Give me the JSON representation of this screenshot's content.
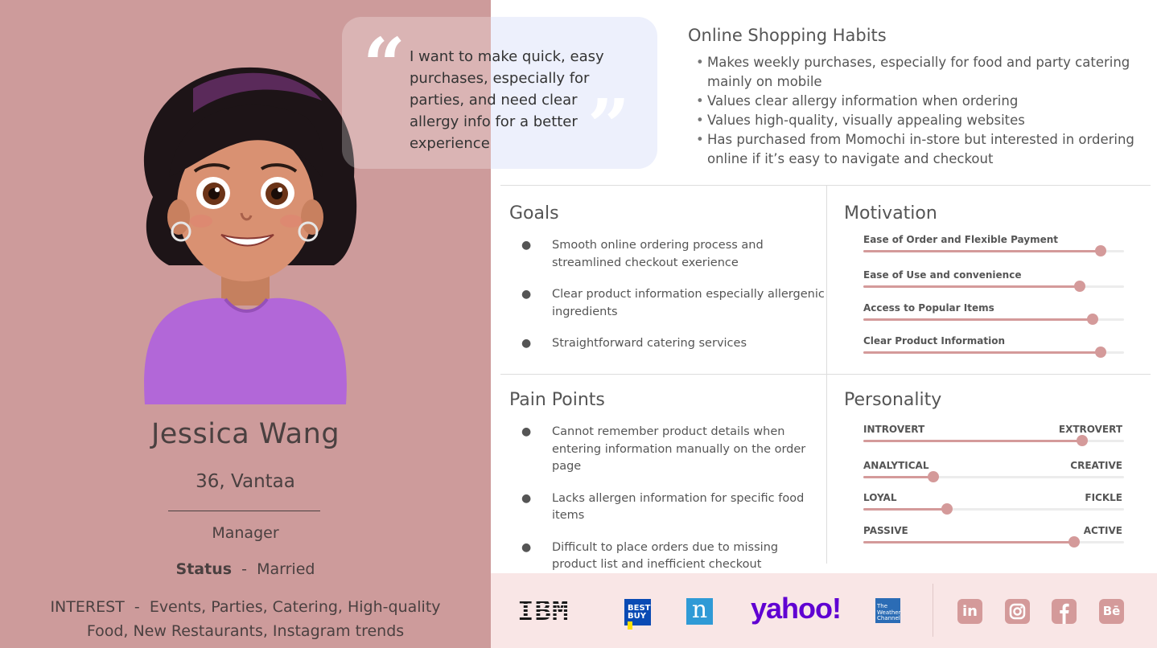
{
  "persona": {
    "name": "Jessica Wang",
    "age_location": "36, Vantaa",
    "job": "Manager",
    "status_label": "Status",
    "status_sep": "-",
    "status_value": "Married",
    "interest_label": "INTEREST",
    "interest_sep": "-",
    "interest_value": "Events, Parties, Catering, High-quality Food, New Restaurants, Instagram trends"
  },
  "quote": {
    "text": "I want to make quick, easy purchases, especially for parties, and need clear allergy info for a better experience"
  },
  "habits": {
    "title": "Online Shopping Habits",
    "items": [
      "Makes weekly purchases, especially for food and party catering mainly on mobile",
      "Values clear allergy information when ordering",
      "Values high-quality, visually appealing websites",
      "Has purchased from Momochi in-store but interested in ordering online if it’s easy to navigate and checkout"
    ]
  },
  "goals": {
    "title": "Goals",
    "bullet": "●",
    "items": [
      "Smooth online ordering process and streamlined checkout exerience",
      "Clear product information especially allergenic ingredients",
      "Straightforward catering services"
    ]
  },
  "pain_points": {
    "title": "Pain Points",
    "bullet": "●",
    "items": [
      "Cannot remember product details when entering information manually on the order page",
      "Lacks allergen information for specific food items",
      "Difficult to place orders due to missing product list and inefficient checkout"
    ]
  },
  "motivation": {
    "title": "Motivation",
    "items": [
      {
        "label": "Ease of Order and Flexible Payment",
        "value": 0.91
      },
      {
        "label": "Ease of Use and convenience",
        "value": 0.83
      },
      {
        "label": "Access to Popular Items",
        "value": 0.88
      },
      {
        "label": "Clear Product Information",
        "value": 0.91
      }
    ]
  },
  "personality": {
    "title": "Personality",
    "items": [
      {
        "left": "INTROVERT",
        "right": "EXTROVERT",
        "value": 0.84
      },
      {
        "left": "ANALYTICAL",
        "right": "CREATIVE",
        "value": 0.27
      },
      {
        "left": "LOYAL",
        "right": "FICKLE",
        "value": 0.32
      },
      {
        "left": "PASSIVE",
        "right": "ACTIVE",
        "value": 0.81
      }
    ]
  },
  "footer": {
    "brands": {
      "ibm": "IBM",
      "bestbuy_top": "BEST",
      "bestbuy_bottom": "BUY",
      "nielsen": "n",
      "yahoo": "yahoo!",
      "weather_line1": "The",
      "weather_line2": "Weather",
      "weather_line3": "Channel"
    },
    "social": {
      "linkedin": "in",
      "behance": "Bē"
    },
    "icons": [
      "linkedin-icon",
      "instagram-icon",
      "facebook-icon",
      "behance-icon"
    ]
  },
  "colors": {
    "left_panel": "#cd9b9b",
    "accent": "#d49a9a",
    "quote_bg": "#edf0fc",
    "footer_bg": "#f9e6e6"
  }
}
